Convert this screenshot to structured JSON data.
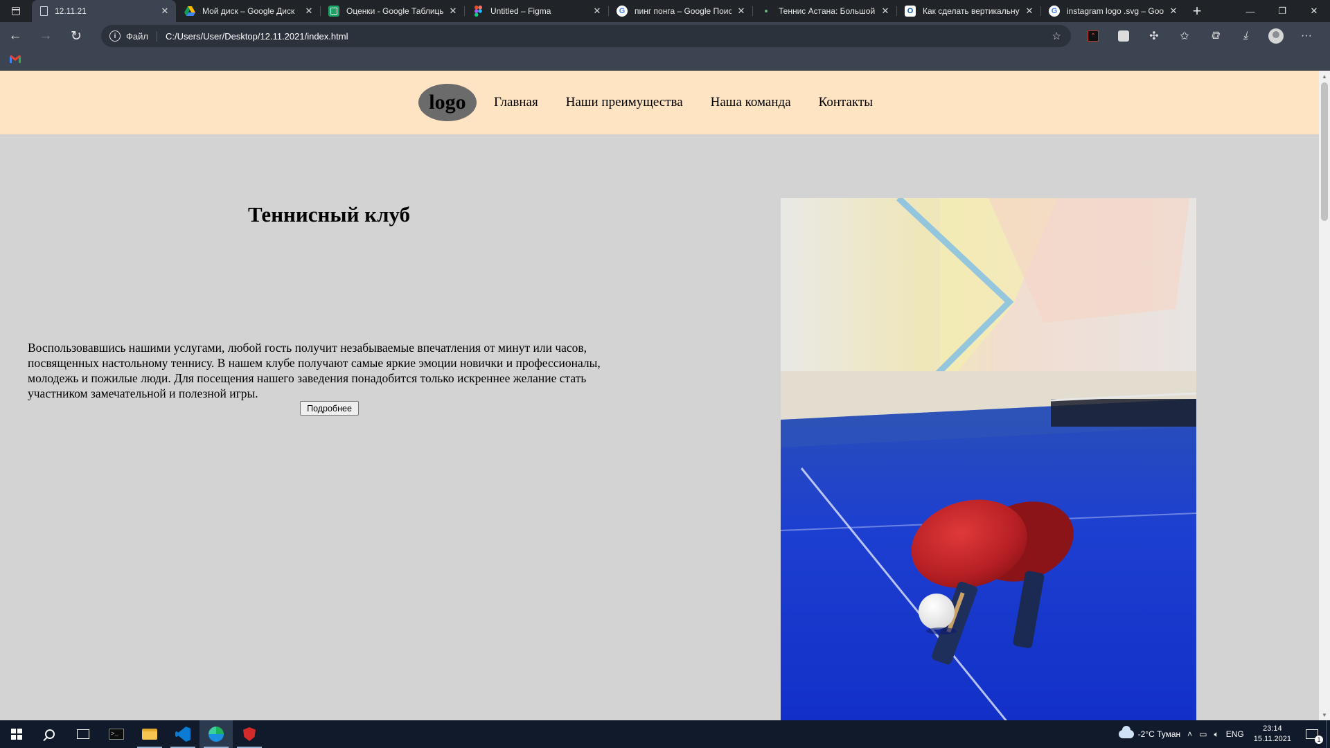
{
  "browser": {
    "tabs": [
      {
        "title": "12.11.21",
        "icon": "page-icon",
        "active": true
      },
      {
        "title": "Мой диск – Google Диск",
        "icon": "google-drive-icon"
      },
      {
        "title": "Оценки - Google Таблицы",
        "icon": "google-sheets-icon"
      },
      {
        "title": "Untitled – Figma",
        "icon": "figma-icon"
      },
      {
        "title": "пинг понга – Google Поиск",
        "icon": "google-icon"
      },
      {
        "title": "Теннис Астана: Большой",
        "icon": "dot-icon"
      },
      {
        "title": "Как сделать вертикальную",
        "icon": "site-o-icon"
      },
      {
        "title": "instagram logo .svg – Goo",
        "icon": "google-icon"
      }
    ],
    "address": {
      "scheme_label": "Файл",
      "url": "C:/Users/User/Desktop/12.11.2021/index.html"
    }
  },
  "page": {
    "logo": "logo",
    "nav": [
      "Главная",
      "Наши преимущества",
      "Наша команда",
      "Контакты"
    ],
    "title": "Теннисный клуб",
    "text": "Воспользовавшись нашими услугами, любой гость получит незабываемые впечатления от минут или часов, посвященных настольному теннису. В нашем клубе получают самые яркие эмоции новички и профессионалы, молодежь и пожилые люди. Для посещения нашего заведения понадобится только искреннее желание стать участником замечательной и полезной игры.",
    "button": "Подробнее",
    "image": "table-tennis-rackets-photo",
    "colors": {
      "header": "#ffe4c4",
      "body": "#d3d3d3",
      "logo": "#6b6b6b"
    }
  },
  "taskbar": {
    "apps": [
      "start-icon",
      "search-icon",
      "task-view-icon",
      "terminal-icon",
      "file-explorer-icon",
      "vscode-icon",
      "edge-icon",
      "security-app-icon"
    ],
    "weather": "-2°C  Туман",
    "lang": "ENG",
    "time": "23:14",
    "date": "15.11.2021"
  }
}
